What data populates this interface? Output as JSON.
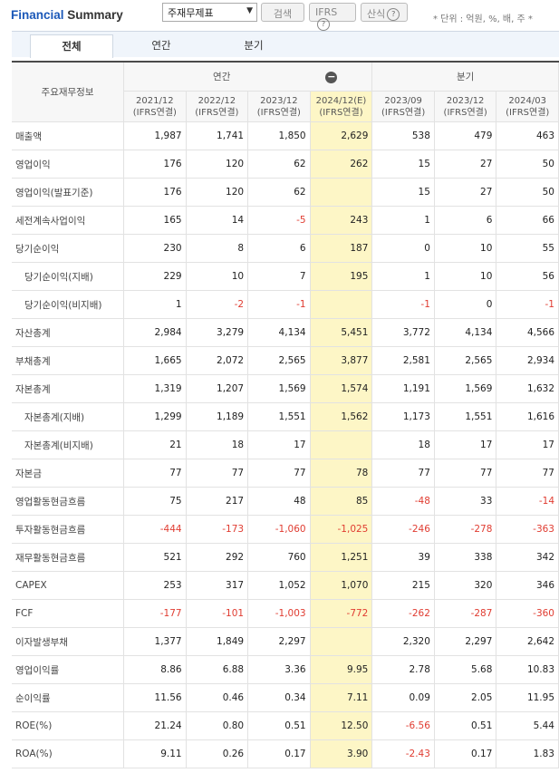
{
  "header": {
    "title_part1": "Financial",
    "title_part2": "Summary",
    "select_value": "주재무제표",
    "search_label": "검색",
    "ifrs_label": "IFRS",
    "calc_label": "산식",
    "help_glyph": "?",
    "unit_text": "* 단위 : 억원, %, 배, 주  *"
  },
  "tabs": [
    "전체",
    "연간",
    "분기"
  ],
  "table": {
    "row_header": "주요재무정보",
    "group_annual": "연간",
    "group_quarter": "분기",
    "collapse_glyph": "−",
    "columns": [
      {
        "period": "2021/12",
        "basis": "(IFRS연결)"
      },
      {
        "period": "2022/12",
        "basis": "(IFRS연결)"
      },
      {
        "period": "2023/12",
        "basis": "(IFRS연결)"
      },
      {
        "period": "2024/12(E)",
        "basis": "(IFRS연결)"
      },
      {
        "period": "2023/09",
        "basis": "(IFRS연결)"
      },
      {
        "period": "2023/12",
        "basis": "(IFRS연결)"
      },
      {
        "period": "2024/03",
        "basis": "(IFRS연결)"
      }
    ],
    "rows": [
      {
        "label": "매출액",
        "sub": false,
        "values": [
          "1,987",
          "1,741",
          "1,850",
          "2,629",
          "538",
          "479",
          "463"
        ]
      },
      {
        "label": "영업이익",
        "sub": false,
        "values": [
          "176",
          "120",
          "62",
          "262",
          "15",
          "27",
          "50"
        ]
      },
      {
        "label": "영업이익(발표기준)",
        "sub": false,
        "values": [
          "176",
          "120",
          "62",
          "",
          "15",
          "27",
          "50"
        ]
      },
      {
        "label": "세전계속사업이익",
        "sub": false,
        "values": [
          "165",
          "14",
          "-5",
          "243",
          "1",
          "6",
          "66"
        ]
      },
      {
        "label": "당기순이익",
        "sub": false,
        "values": [
          "230",
          "8",
          "6",
          "187",
          "0",
          "10",
          "55"
        ]
      },
      {
        "label": "당기순이익(지배)",
        "sub": true,
        "values": [
          "229",
          "10",
          "7",
          "195",
          "1",
          "10",
          "56"
        ]
      },
      {
        "label": "당기순이익(비지배)",
        "sub": true,
        "values": [
          "1",
          "-2",
          "-1",
          "",
          "-1",
          "0",
          "-1"
        ]
      },
      {
        "label": "자산총계",
        "sub": false,
        "values": [
          "2,984",
          "3,279",
          "4,134",
          "5,451",
          "3,772",
          "4,134",
          "4,566"
        ]
      },
      {
        "label": "부채총계",
        "sub": false,
        "values": [
          "1,665",
          "2,072",
          "2,565",
          "3,877",
          "2,581",
          "2,565",
          "2,934"
        ]
      },
      {
        "label": "자본총계",
        "sub": false,
        "values": [
          "1,319",
          "1,207",
          "1,569",
          "1,574",
          "1,191",
          "1,569",
          "1,632"
        ]
      },
      {
        "label": "자본총계(지배)",
        "sub": true,
        "values": [
          "1,299",
          "1,189",
          "1,551",
          "1,562",
          "1,173",
          "1,551",
          "1,616"
        ]
      },
      {
        "label": "자본총계(비지배)",
        "sub": true,
        "values": [
          "21",
          "18",
          "17",
          "",
          "18",
          "17",
          "17"
        ]
      },
      {
        "label": "자본금",
        "sub": false,
        "values": [
          "77",
          "77",
          "77",
          "78",
          "77",
          "77",
          "77"
        ]
      },
      {
        "label": "영업활동현금흐름",
        "sub": false,
        "values": [
          "75",
          "217",
          "48",
          "85",
          "-48",
          "33",
          "-14"
        ]
      },
      {
        "label": "투자활동현금흐름",
        "sub": false,
        "values": [
          "-444",
          "-173",
          "-1,060",
          "-1,025",
          "-246",
          "-278",
          "-363"
        ]
      },
      {
        "label": "재무활동현금흐름",
        "sub": false,
        "values": [
          "521",
          "292",
          "760",
          "1,251",
          "39",
          "338",
          "342"
        ]
      },
      {
        "label": "CAPEX",
        "sub": false,
        "values": [
          "253",
          "317",
          "1,052",
          "1,070",
          "215",
          "320",
          "346"
        ]
      },
      {
        "label": "FCF",
        "sub": false,
        "values": [
          "-177",
          "-101",
          "-1,003",
          "-772",
          "-262",
          "-287",
          "-360"
        ]
      },
      {
        "label": "이자발생부채",
        "sub": false,
        "values": [
          "1,377",
          "1,849",
          "2,297",
          "",
          "2,320",
          "2,297",
          "2,642"
        ]
      },
      {
        "label": "영업이익률",
        "sub": false,
        "values": [
          "8.86",
          "6.88",
          "3.36",
          "9.95",
          "2.78",
          "5.68",
          "10.83"
        ]
      },
      {
        "label": "순이익률",
        "sub": false,
        "values": [
          "11.56",
          "0.46",
          "0.34",
          "7.11",
          "0.09",
          "2.05",
          "11.95"
        ]
      },
      {
        "label": "ROE(%)",
        "sub": false,
        "values": [
          "21.24",
          "0.80",
          "0.51",
          "12.50",
          "-6.56",
          "0.51",
          "5.44"
        ]
      },
      {
        "label": "ROA(%)",
        "sub": false,
        "values": [
          "9.11",
          "0.26",
          "0.17",
          "3.90",
          "-2.43",
          "0.17",
          "1.83"
        ]
      }
    ]
  }
}
